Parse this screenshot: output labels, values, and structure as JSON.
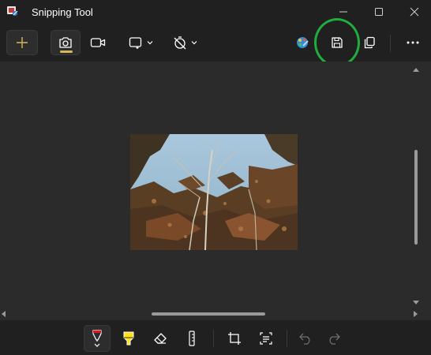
{
  "window": {
    "title": "Snipping Tool",
    "minimize_icon": "minimize-icon",
    "maximize_icon": "maximize-icon",
    "close_icon": "close-icon"
  },
  "toolbar": {
    "new_icon": "plus-icon",
    "modes": [
      "camera-icon",
      "video-camera-icon"
    ],
    "selected_mode": "snip",
    "shape_dropdown_icon": "rectangle-snip-icon",
    "delay_dropdown_icon": "no-timer-icon",
    "edit_in_paint_icon": "paint-icon",
    "save_icon": "save-icon",
    "copy_icon": "copy-icon",
    "more_icon": "more-icon",
    "highlight_color": "#1fae3d",
    "accent_color": "#d8b75a"
  },
  "canvas": {
    "image_description_icon": "snip-image"
  },
  "bottom_toolbar": {
    "tools": [
      "ballpoint-pen-icon",
      "highlighter-icon",
      "eraser-icon",
      "ruler-icon",
      "crop-icon",
      "text-actions-icon",
      "undo-icon",
      "redo-icon"
    ],
    "pen_color": "#e81123",
    "highlighter_color": "#ffe11a"
  }
}
